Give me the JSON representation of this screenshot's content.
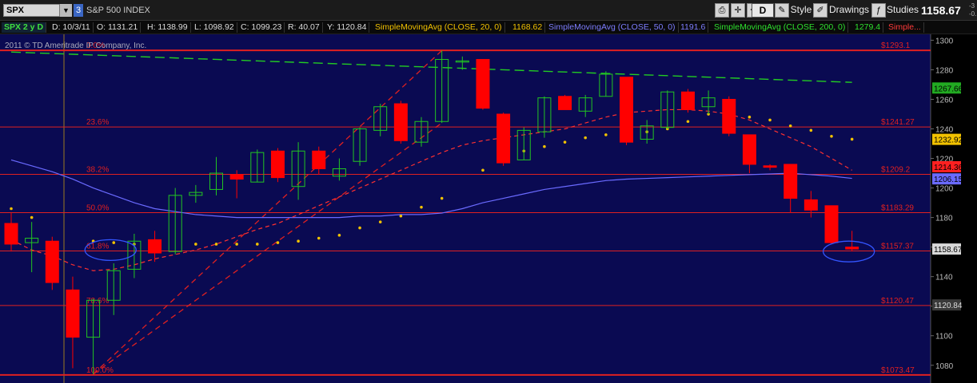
{
  "toolbar": {
    "symbol": "SPX",
    "link_number": "3",
    "description": "S&P 500 INDEX",
    "d_button": "D",
    "style_label": "Style",
    "drawings_label": "Drawings",
    "studies_label": "Studies",
    "last_price": "1158.67",
    "change_top": "-3",
    "change_bottom": "-0."
  },
  "info_bar": {
    "symbol_period": "SPX 2 y D",
    "date": "D: 10/3/11",
    "open": "O: 1131.21",
    "high": "H: 1138.99",
    "low": "L: 1098.92",
    "close": "C: 1099.23",
    "range": "R: 40.07",
    "y": "Y: 1120.84",
    "sma20_label": "SimpleMovingAvg (CLOSE, 20, 0)",
    "sma20_value": "1168.62",
    "sma50_label": "SimpleMovingAvg (CLOSE, 50, 0)",
    "sma50_value": "1191.6",
    "sma200_label": "SimpleMovingAvg (CLOSE, 200, 0)",
    "sma200_value": "1279.4",
    "simple_label": "Simple..."
  },
  "copyright": "2011 © TD Ameritrade IP Company, Inc.",
  "colors": {
    "background": "#0a0a52",
    "up_candle": "#22c522",
    "down_candle": "#ff0000",
    "fib_line": "#e02020",
    "sma20": "#ff3030",
    "sma50": "#6a6aff",
    "sma200": "#22cc22",
    "sar_dot": "#f2c200",
    "annotation_circle": "#3355ff"
  },
  "chart_data": {
    "type": "candlestick",
    "ylim": [
      1068,
      1304
    ],
    "y_ticks": [
      1080,
      1100,
      1120,
      1140,
      1160,
      1180,
      1200,
      1220,
      1240,
      1260,
      1280,
      1300
    ],
    "price_markers": [
      {
        "value": 1267.66,
        "label": "1267.66",
        "bg": "#22aa22",
        "fg": "#000"
      },
      {
        "value": 1232.92,
        "label": "1232.92",
        "bg": "#f2c200",
        "fg": "#000"
      },
      {
        "value": 1214.36,
        "label": "1214.36",
        "bg": "#ff2020",
        "fg": "#000"
      },
      {
        "value": 1206.15,
        "label": "1206.15",
        "bg": "#6a6aff",
        "fg": "#000"
      },
      {
        "value": 1158.67,
        "label": "1158.67",
        "bg": "#d8d8d8",
        "fg": "#000"
      },
      {
        "value": 1120.84,
        "label": "1120.84",
        "bg": "#3a3a3a",
        "fg": "#ddd"
      }
    ],
    "fib_levels": [
      {
        "pct": "0.0%",
        "value": 1293.1,
        "label": "$1293.1"
      },
      {
        "pct": "23.6%",
        "value": 1241.27,
        "label": "$1241.27"
      },
      {
        "pct": "38.2%",
        "value": 1209.2,
        "label": "$1209.2"
      },
      {
        "pct": "50.0%",
        "value": 1183.29,
        "label": "$1183.29"
      },
      {
        "pct": "61.8%",
        "value": 1157.37,
        "label": "$1157.37"
      },
      {
        "pct": "78.6%",
        "value": 1120.47,
        "label": "$1120.47"
      },
      {
        "pct": "100.0%",
        "value": 1073.47,
        "label": "$1073.47"
      }
    ],
    "candles": [
      {
        "o": 1176,
        "h": 1183,
        "l": 1157,
        "c": 1162
      },
      {
        "o": 1163,
        "h": 1177,
        "l": 1143,
        "c": 1166
      },
      {
        "o": 1164,
        "h": 1167,
        "l": 1131,
        "c": 1136
      },
      {
        "o": 1131,
        "h": 1140,
        "l": 1078,
        "c": 1099
      },
      {
        "o": 1099,
        "h": 1125,
        "l": 1074,
        "c": 1124
      },
      {
        "o": 1124,
        "h": 1149,
        "l": 1114,
        "c": 1144
      },
      {
        "o": 1145,
        "h": 1169,
        "l": 1139,
        "c": 1164
      },
      {
        "o": 1165,
        "h": 1171,
        "l": 1150,
        "c": 1156
      },
      {
        "o": 1157,
        "h": 1200,
        "l": 1155,
        "c": 1195
      },
      {
        "o": 1195,
        "h": 1202,
        "l": 1190,
        "c": 1197
      },
      {
        "o": 1199,
        "h": 1221,
        "l": 1195,
        "c": 1210
      },
      {
        "o": 1209,
        "h": 1212,
        "l": 1193,
        "c": 1206
      },
      {
        "o": 1204,
        "h": 1226,
        "l": 1204,
        "c": 1224
      },
      {
        "o": 1225,
        "h": 1227,
        "l": 1204,
        "c": 1207
      },
      {
        "o": 1201,
        "h": 1231,
        "l": 1192,
        "c": 1225
      },
      {
        "o": 1225,
        "h": 1228,
        "l": 1209,
        "c": 1213
      },
      {
        "o": 1208,
        "h": 1220,
        "l": 1205,
        "c": 1213
      },
      {
        "o": 1218,
        "h": 1241,
        "l": 1215,
        "c": 1240
      },
      {
        "o": 1239,
        "h": 1257,
        "l": 1235,
        "c": 1255
      },
      {
        "o": 1257,
        "h": 1259,
        "l": 1230,
        "c": 1232
      },
      {
        "o": 1231,
        "h": 1248,
        "l": 1228,
        "c": 1245
      },
      {
        "o": 1245,
        "h": 1293,
        "l": 1244,
        "c": 1287
      },
      {
        "o": 1286,
        "h": 1289,
        "l": 1280,
        "c": 1286
      },
      {
        "o": 1287,
        "h": 1287,
        "l": 1253,
        "c": 1254
      },
      {
        "o": 1250,
        "h": 1251,
        "l": 1215,
        "c": 1217
      },
      {
        "o": 1219,
        "h": 1241,
        "l": 1219,
        "c": 1239
      },
      {
        "o": 1238,
        "h": 1262,
        "l": 1234,
        "c": 1261
      },
      {
        "o": 1262,
        "h": 1263,
        "l": 1253,
        "c": 1253
      },
      {
        "o": 1252,
        "h": 1263,
        "l": 1248,
        "c": 1261
      },
      {
        "o": 1262,
        "h": 1279,
        "l": 1262,
        "c": 1277
      },
      {
        "o": 1275,
        "h": 1275,
        "l": 1229,
        "c": 1231
      },
      {
        "o": 1233,
        "h": 1246,
        "l": 1230,
        "c": 1242
      },
      {
        "o": 1241,
        "h": 1266,
        "l": 1240,
        "c": 1265
      },
      {
        "o": 1265,
        "h": 1267,
        "l": 1251,
        "c": 1253
      },
      {
        "o": 1255,
        "h": 1266,
        "l": 1250,
        "c": 1261
      },
      {
        "o": 1260,
        "h": 1262,
        "l": 1235,
        "c": 1237
      },
      {
        "o": 1236,
        "h": 1236,
        "l": 1210,
        "c": 1216
      },
      {
        "o": 1215,
        "h": 1216,
        "l": 1212,
        "c": 1214
      },
      {
        "o": 1216,
        "h": 1216,
        "l": 1183,
        "c": 1193
      },
      {
        "o": 1192,
        "h": 1198,
        "l": 1180,
        "c": 1185
      },
      {
        "o": 1188,
        "h": 1188,
        "l": 1162,
        "c": 1163
      },
      {
        "o": 1160,
        "h": 1171,
        "l": 1157,
        "c": 1158.67
      }
    ],
    "sma20": [
      1165,
      1158,
      1154,
      1148,
      1144,
      1145,
      1148,
      1152,
      1155,
      1158,
      1162,
      1167,
      1172,
      1176,
      1182,
      1188,
      1194,
      1200,
      1206,
      1212,
      1218,
      1224,
      1229,
      1232,
      1234,
      1236,
      1238,
      1240,
      1244,
      1248,
      1251,
      1252,
      1253,
      1253,
      1252,
      1250,
      1246,
      1240,
      1234,
      1228,
      1220,
      1212
    ],
    "sma50": [
      1219,
      1215,
      1211,
      1206,
      1200,
      1195,
      1190,
      1186,
      1184,
      1182,
      1181,
      1180,
      1180,
      1180,
      1180,
      1180,
      1180,
      1181,
      1181,
      1182,
      1182,
      1183,
      1186,
      1190,
      1193,
      1196,
      1199,
      1201,
      1203,
      1205,
      1206,
      1206.5,
      1207,
      1207.5,
      1208,
      1208.5,
      1209,
      1209.5,
      1210,
      1209,
      1208,
      1206.5
    ],
    "sma200": [
      1292,
      1291.5,
      1291,
      1290.5,
      1290,
      1289.5,
      1289,
      1288.5,
      1288,
      1287.5,
      1287,
      1286.5,
      1286,
      1285.5,
      1285,
      1284.5,
      1284,
      1283.5,
      1283,
      1282.5,
      1282,
      1281.5,
      1281,
      1280.5,
      1280,
      1279.5,
      1279,
      1278.5,
      1278,
      1277.5,
      1277,
      1276.5,
      1276,
      1275.5,
      1275,
      1274.5,
      1274,
      1273.5,
      1273,
      1272.5,
      1272,
      1271.5
    ],
    "sar_dots": [
      {
        "i": 0,
        "v": 1186
      },
      {
        "i": 1,
        "v": 1180
      },
      {
        "i": 4,
        "v": 1164
      },
      {
        "i": 5,
        "v": 1163
      },
      {
        "i": 6,
        "v": 1162
      },
      {
        "i": 9,
        "v": 1162
      },
      {
        "i": 10,
        "v": 1162
      },
      {
        "i": 11,
        "v": 1162
      },
      {
        "i": 12,
        "v": 1162
      },
      {
        "i": 13,
        "v": 1163
      },
      {
        "i": 14,
        "v": 1164
      },
      {
        "i": 15,
        "v": 1166
      },
      {
        "i": 16,
        "v": 1168
      },
      {
        "i": 17,
        "v": 1173
      },
      {
        "i": 18,
        "v": 1177
      },
      {
        "i": 19,
        "v": 1181
      },
      {
        "i": 20,
        "v": 1187
      },
      {
        "i": 21,
        "v": 1193
      },
      {
        "i": 23,
        "v": 1212
      },
      {
        "i": 24,
        "v": 1220
      },
      {
        "i": 25,
        "v": 1225
      },
      {
        "i": 26,
        "v": 1228
      },
      {
        "i": 27,
        "v": 1231
      },
      {
        "i": 28,
        "v": 1234
      },
      {
        "i": 29,
        "v": 1236
      },
      {
        "i": 30,
        "v": 1236
      },
      {
        "i": 31,
        "v": 1238
      },
      {
        "i": 32,
        "v": 1240
      },
      {
        "i": 33,
        "v": 1245
      },
      {
        "i": 34,
        "v": 1250
      },
      {
        "i": 35,
        "v": 1249
      },
      {
        "i": 36,
        "v": 1248
      },
      {
        "i": 37,
        "v": 1246
      },
      {
        "i": 38,
        "v": 1242
      },
      {
        "i": 39,
        "v": 1239
      },
      {
        "i": 40,
        "v": 1235
      },
      {
        "i": 41,
        "v": 1233
      }
    ],
    "trend_lines": [
      {
        "from": {
          "i": 4,
          "v": 1074
        },
        "to": {
          "i": 21,
          "v": 1293
        }
      },
      {
        "from": {
          "i": 4,
          "v": 1074
        },
        "to": {
          "i": 21,
          "v": 1244
        }
      }
    ],
    "annotations": [
      {
        "type": "ellipse",
        "center": {
          "i": 5,
          "v": 1158
        }
      },
      {
        "type": "ellipse",
        "center": {
          "i": 41,
          "v": 1157
        }
      }
    ]
  }
}
